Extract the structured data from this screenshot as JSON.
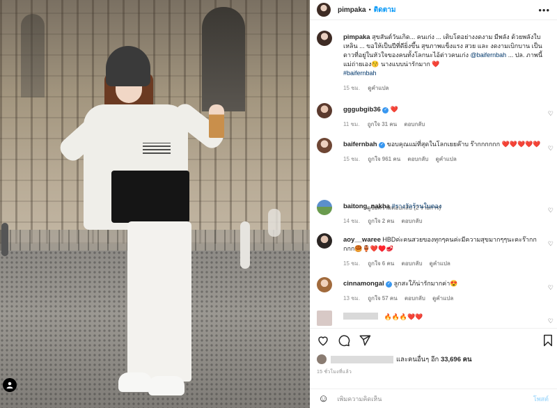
{
  "post": {
    "author": "pimpaka",
    "follow_label": "ติดตาม",
    "more_label": "•••",
    "caption_user": "pimpaka",
    "caption_text": "สุขสันต์วันเกิด... คนเก่ง ... เติบโตอย่างงดงาม มีพลัง ด้วยพลังใบเหลิน ... ขอให้เป็นปีที่ดียิ่งขึ้น สุขภาพแข็งแรง สวย และ งดงามเบิกบาน เป็นดาวที่อยู่ในหัวใจของคนทั้งโลกนะไอ้ต่าวคนเก่ง",
    "caption_tag": "@baifernbah",
    "caption_text2": "... ปล. ภาพนี้แม่ถ่ายเอง😚 นางแบบน่ารักมาก ❤️",
    "caption_hashtag": "#baifernbah",
    "caption_time": "15 ชม.",
    "translate_label": "ดูคำแปล"
  },
  "comments": [
    {
      "user": "gggubgib36",
      "text": "❤️",
      "time": "11 ชม.",
      "likes": "ถูกใจ 31 คน",
      "reply": "ตอบกลับ"
    },
    {
      "user": "baifernbah",
      "text": "ขอบคุณแม่ที่สุดในโลกเยยค๊าบ ร๊ากกกกกก ❤️❤️❤️❤️❤️",
      "time": "15 ชม.",
      "likes": "ถูกใจ 961 คน",
      "reply": "ตอบกลับ",
      "translate": "ดูคำแปล"
    },
    {
      "user": "baitong_nakha",
      "text": "#รางวัลร้านใบตอง",
      "time": "14 ชม.",
      "likes": "ถูกใจ 2 คน",
      "reply": "ตอบกลับ"
    },
    {
      "user": "aoy__waree",
      "text": "HBDค่ะคนสวยของทุกๆคนค่ะมีความสุขมากๆๆนะคะร๊ากกกกก🥮🏺❤️♥️🥩",
      "time": "15 ชม.",
      "likes": "ถูกใจ 6 คน",
      "reply": "ตอบกลับ",
      "translate": "ดูคำแปล"
    },
    {
      "user": "cinnamongal",
      "text": "ลูกสะใภ้น่ารักมากค่า😍",
      "time": "13 ชม.",
      "likes": "ถูกใจ 57 คน",
      "reply": "ตอบกลับ",
      "translate": "ดูคำแปล"
    },
    {
      "text": "🔥🔥🔥❤️❤️"
    }
  ],
  "view_replies": "ดูข้อความตอบกลับ (2 รายการ)",
  "likes_summary": {
    "text": "และคนอื่นๆ อีก",
    "count": "33,696 คน"
  },
  "post_time": "15 ชั่วโมงที่แล้ว",
  "add_comment": {
    "placeholder": "เพิ่มความคิดเห็น",
    "post_label": "โพสต์"
  },
  "icons": [
    "heart-icon",
    "comment-icon",
    "share-icon",
    "bookmark-icon",
    "emoji-icon",
    "user-tag-icon"
  ],
  "colors": {
    "link": "#0095f6",
    "verified": "#3897f0",
    "heart": "#ed4956"
  }
}
